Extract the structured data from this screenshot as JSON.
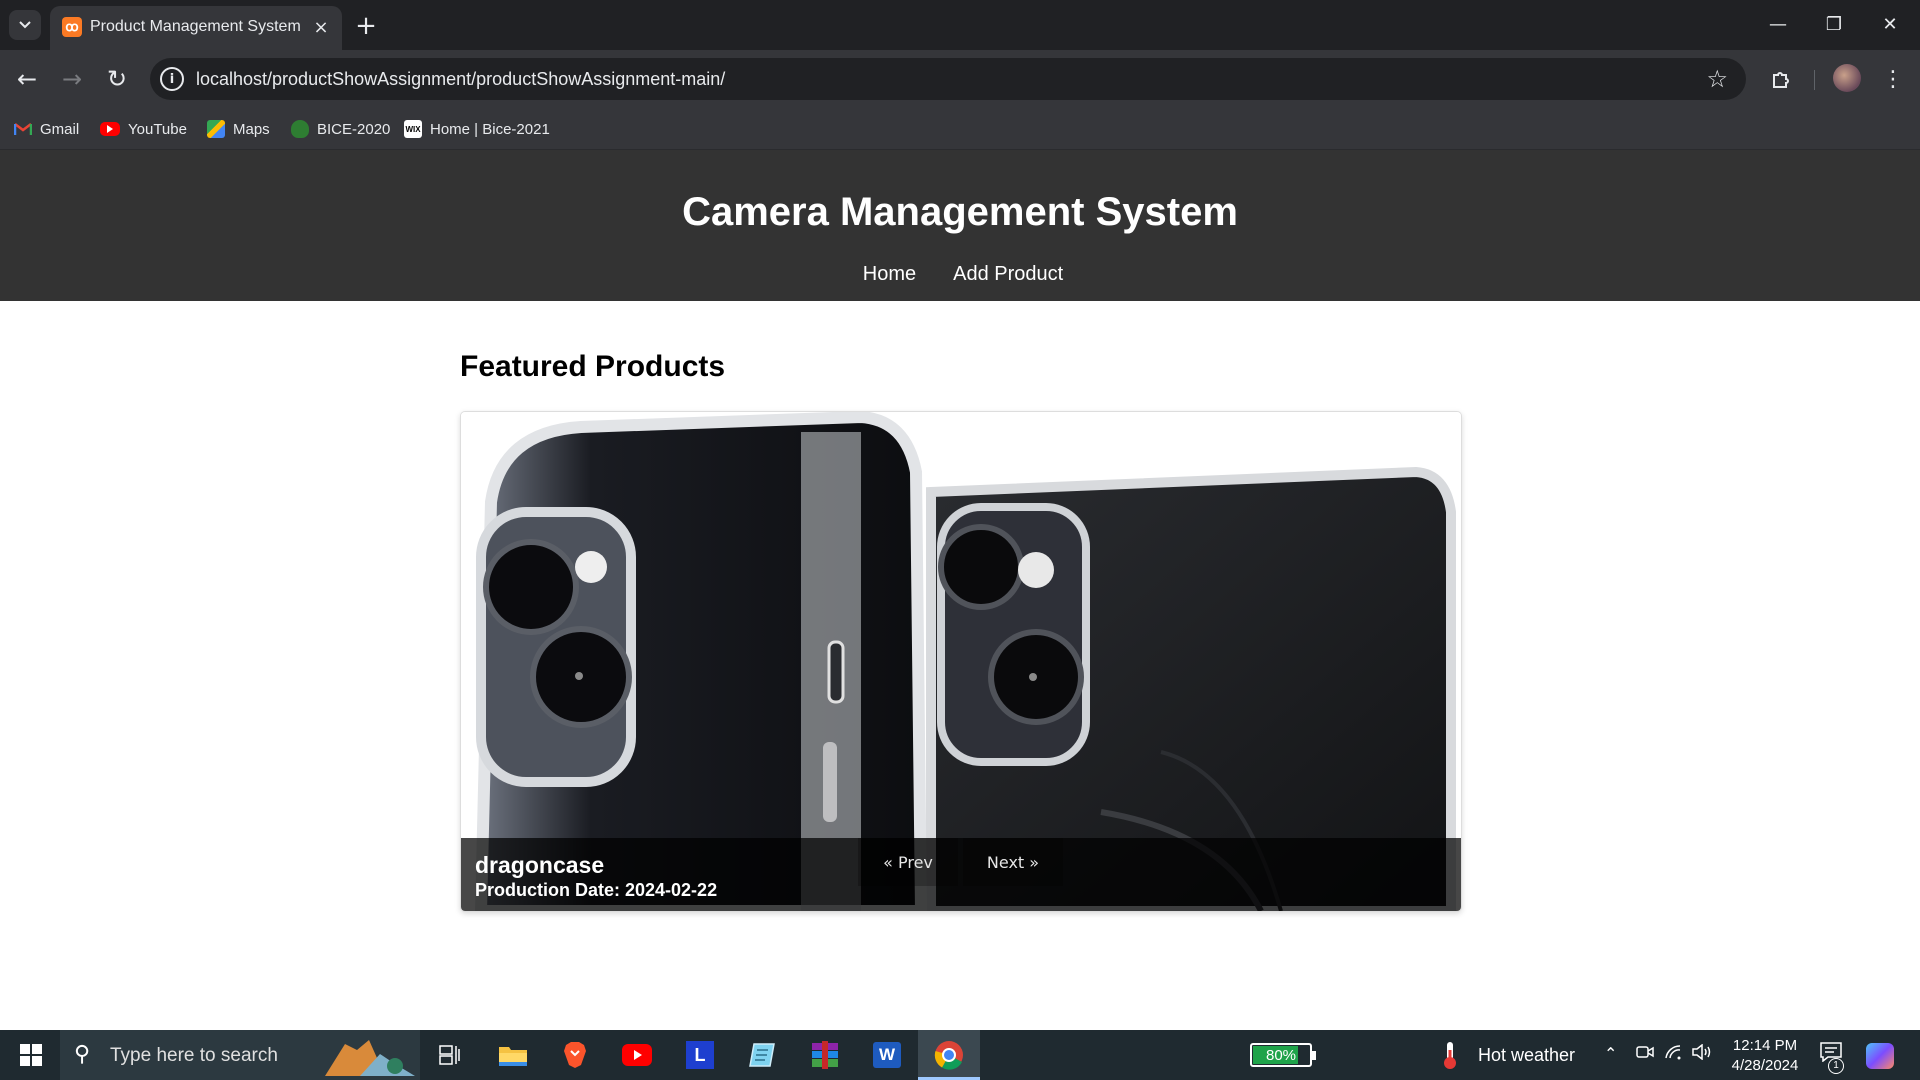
{
  "browser": {
    "tab": {
      "title": "Product Management System",
      "favicon": "xampp-icon"
    },
    "new_tab_label": "+",
    "window_controls": {
      "minimize": "—",
      "restore": "❐",
      "close": "✕"
    },
    "url": "localhost/productShowAssignment/productShowAssignment-main/",
    "bookmarks": [
      {
        "label": "Gmail",
        "icon": "gmail-icon"
      },
      {
        "label": "YouTube",
        "icon": "youtube-icon"
      },
      {
        "label": "Maps",
        "icon": "maps-icon"
      },
      {
        "label": "BICE-2020",
        "icon": "bice-icon"
      },
      {
        "label": "Home | Bice-2021",
        "icon": "wix-icon"
      }
    ]
  },
  "page": {
    "site_title": "Camera Management System",
    "nav": [
      {
        "label": "Home"
      },
      {
        "label": "Add Product"
      }
    ],
    "section_title": "Featured Products",
    "slider": {
      "product_name": "dragoncase",
      "production_date": "Production Date: 2024-02-22",
      "prev_label": "« Prev",
      "next_label": "Next »"
    }
  },
  "taskbar": {
    "search_placeholder": "Type here to search",
    "apps": [
      "task-view-icon",
      "file-explorer-icon",
      "brave-icon",
      "youtube-icon",
      "lightshot-icon",
      "notepad-icon",
      "winrar-icon",
      "word-icon",
      "chrome-icon"
    ],
    "battery_percent": "80%",
    "battery_level": 0.8,
    "weather": "Hot weather",
    "time": "12:14 PM",
    "date": "4/28/2024",
    "notification_count": "1"
  },
  "colors": {
    "header_bg": "#333333",
    "chrome_dark": "#202124",
    "chrome_toolbar": "#35363a",
    "taskbar_bg": "#1f2a30",
    "battery_green": "#1fa34a"
  }
}
